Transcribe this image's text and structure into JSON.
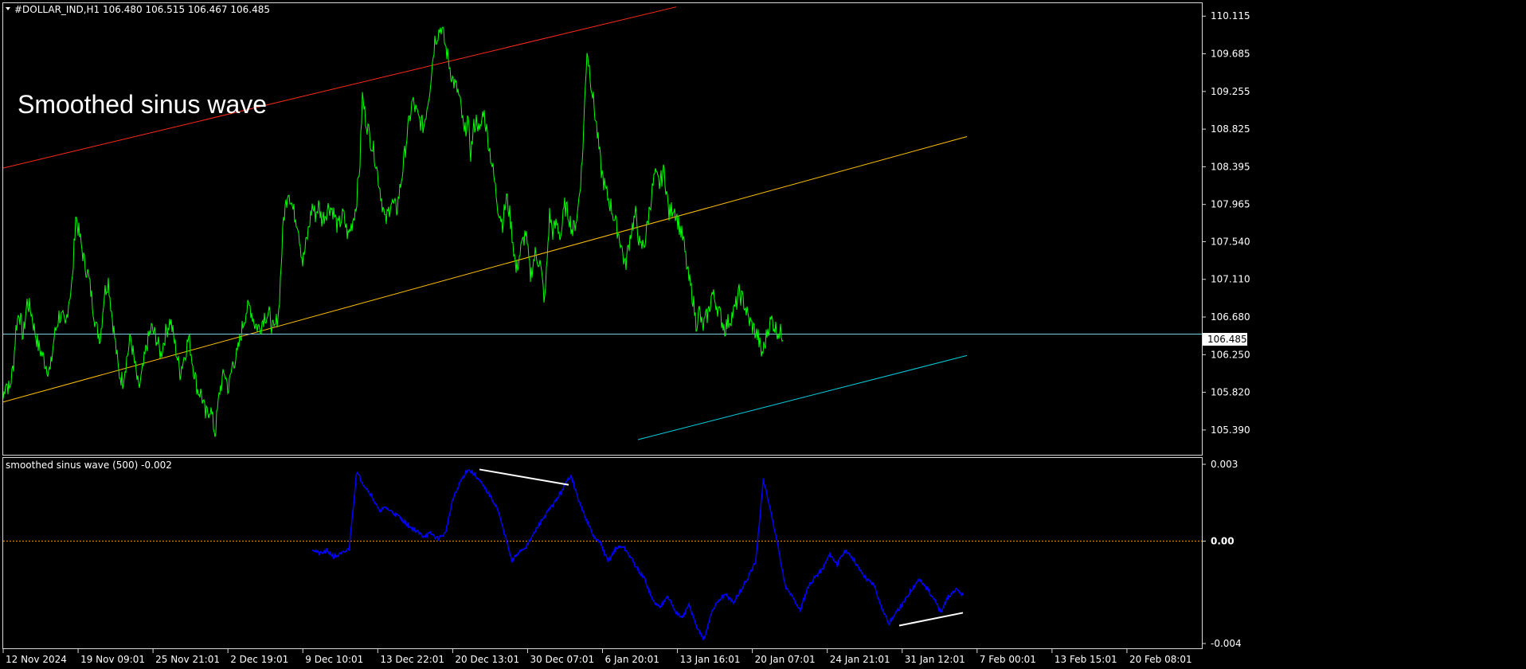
{
  "symbol_header": "#DOLLAR_IND,H1",
  "ohlc": {
    "open": "106.480",
    "high": "106.515",
    "low": "106.467",
    "close": "106.485"
  },
  "overlay_label": "Smoothed sinus wave",
  "indicator_header": "smoothed sinus wave  (500) -0.002",
  "current_price": "106.485",
  "colors": {
    "price_line": "#00ff00",
    "indicator_line": "#0000ff",
    "red_channel": "#ff2a1a",
    "yellow_channel": "#ffc000",
    "cyan_channel": "#00d0e0",
    "price_hline": "#7fcfe0",
    "zero_line": "#ff9900",
    "divergence": "#ffffff",
    "background": "#000000",
    "frame": "#d8d8d8"
  },
  "chart_data": [
    {
      "type": "line",
      "series_name": "#DOLLAR_IND,H1",
      "y_ticks": [
        "110.115",
        "109.685",
        "109.255",
        "108.825",
        "108.395",
        "107.965",
        "107.540",
        "107.110",
        "106.680",
        "106.250",
        "105.820",
        "105.390"
      ],
      "ylim": [
        105.28,
        110.19
      ],
      "x_ticks": [
        "12 Nov 2024",
        "19 Nov 09:01",
        "25 Nov 21:01",
        "2 Dec 19:01",
        "9 Dec 10:01",
        "13 Dec 22:01",
        "20 Dec 13:01",
        "30 Dec 07:01",
        "6 Jan 20:01",
        "13 Jan 16:01",
        "20 Jan 07:01",
        "24 Jan 21:01",
        "31 Jan 12:01",
        "7 Feb 00:01",
        "13 Feb 15:01",
        "20 Feb 08:01"
      ],
      "x_index": [
        0,
        3,
        8,
        13,
        16,
        20,
        25,
        30,
        35,
        39,
        44,
        49,
        53,
        59,
        64,
        70,
        75,
        78,
        82,
        87,
        91,
        97,
        102,
        107,
        112,
        117,
        122,
        127,
        132,
        136,
        140,
        145,
        150,
        155,
        160,
        165,
        170,
        175,
        180,
        186,
        192,
        198,
        204,
        210,
        216,
        222,
        228,
        233,
        238,
        244,
        249,
        254,
        260,
        266,
        272,
        278,
        283,
        288,
        294,
        300,
        305,
        310,
        316,
        322,
        328,
        334,
        340,
        346,
        352,
        358,
        364,
        370,
        376,
        382,
        388,
        392,
        396,
        400,
        404,
        409,
        414,
        420,
        427,
        433,
        438,
        443,
        448,
        451,
        455,
        460,
        466,
        473,
        480,
        487,
        494,
        500,
        507,
        514,
        521,
        528,
        535,
        542,
        550,
        557,
        564,
        571,
        575,
        579,
        583,
        587,
        591,
        595,
        598,
        603,
        609,
        615,
        621,
        627,
        632,
        636,
        640,
        644,
        650,
        656,
        662,
        668,
        674,
        680,
        686,
        690,
        695,
        700,
        705,
        710,
        715,
        721,
        727,
        733,
        739,
        745,
        751,
        757,
        763,
        769,
        775,
        781,
        788,
        794,
        800,
        806,
        812,
        818,
        824,
        830,
        836,
        842,
        848,
        854,
        860,
        866,
        870,
        874,
        878,
        882,
        886,
        890,
        895,
        900,
        906,
        912,
        918,
        924,
        930,
        936,
        942,
        948,
        952,
        956,
        960,
        965,
        970,
        975,
        980,
        985,
        990,
        995,
        1000,
        1005,
        1010,
        1016,
        1022,
        1028,
        1034,
        1040,
        1046,
        1052,
        1058,
        1064,
        1070,
        1076,
        1082,
        1086,
        1090,
        1095,
        1100,
        1105,
        1110,
        1115,
        1120,
        1125,
        1130,
        1135,
        1140,
        1145,
        1150,
        1155,
        1160,
        1166,
        1172,
        1178,
        1184,
        1188,
        1192,
        1196,
        1200,
        1205
      ],
      "price": [
        105.75,
        105.95,
        105.85,
        106.15,
        106.55,
        106.75,
        106.45,
        106.85,
        106.75,
        106.55,
        106.35,
        106.25,
        106.15,
        106.05,
        106.45,
        106.7,
        106.65,
        106.55,
        106.85,
        107.1,
        107.85,
        107.55,
        107.3,
        107.15,
        106.85,
        106.55,
        106.45,
        106.95,
        107.1,
        106.75,
        106.45,
        106.05,
        105.95,
        106.2,
        106.45,
        106.15,
        105.85,
        106.05,
        106.35,
        106.55,
        106.45,
        106.25,
        106.5,
        106.65,
        106.35,
        106.05,
        106.25,
        106.45,
        106.15,
        105.85,
        105.8,
        105.55,
        105.65,
        105.35,
        105.85,
        106.05,
        105.85,
        106.15,
        106.25,
        106.55,
        106.75,
        106.8,
        106.6,
        106.55,
        106.7,
        106.7,
        106.5,
        106.75,
        107.8,
        108.15,
        107.9,
        107.75,
        107.3,
        107.6,
        107.95,
        107.85,
        107.95,
        107.8,
        107.85,
        107.95,
        107.9,
        107.7,
        107.85,
        107.6,
        107.75,
        107.95,
        108.45,
        109.2,
        108.95,
        108.75,
        108.55,
        108.15,
        107.75,
        108.0,
        107.9,
        108.25,
        108.75,
        109.15,
        108.95,
        108.85,
        109.25,
        109.85,
        110.0,
        109.7,
        109.4,
        109.25,
        109.05,
        108.75,
        108.95,
        108.55,
        108.85,
        108.95,
        108.75,
        109.05,
        108.7,
        108.35,
        107.95,
        107.75,
        108.05,
        107.85,
        107.55,
        107.2,
        107.45,
        107.65,
        107.15,
        107.4,
        107.3,
        106.85,
        107.85,
        107.65,
        107.75,
        107.6,
        107.95,
        107.85,
        107.65,
        107.85,
        108.45,
        109.75,
        109.3,
        108.85,
        108.35,
        108.1,
        107.95,
        107.75,
        107.55,
        107.25,
        107.65,
        107.85,
        107.45,
        107.55,
        107.95,
        108.3,
        108.2,
        108.35,
        107.85,
        107.95,
        107.75,
        107.55,
        107.15,
        106.9,
        106.6,
        106.75,
        106.55,
        106.65,
        106.75,
        106.95,
        106.85,
        106.7,
        106.55,
        106.65,
        106.75,
        106.95,
        106.85,
        106.65,
        106.55,
        106.45,
        106.25,
        106.35,
        106.55,
        106.65,
        106.55,
        106.5,
        106.485
      ],
      "indicator_ylim": [
        -0.004,
        0.003
      ],
      "indicator_ticks": [
        "0.003",
        "0.00",
        "-0.004"
      ],
      "indicator_start_index": 388,
      "indicator": [
        -0.0003,
        -0.0005,
        -0.0004,
        -0.0006,
        -0.0005,
        -0.0003,
        0.0027,
        0.0022,
        0.0018,
        0.0012,
        0.0013,
        0.0011,
        0.0009,
        0.0006,
        0.0004,
        0.0002,
        0.0003,
        0.0001,
        0.0003,
        0.0016,
        0.0023,
        0.0028,
        0.0026,
        0.0022,
        0.0018,
        0.0013,
        0.0003,
        -0.0008,
        -0.0004,
        -0.0002,
        0.0003,
        0.0008,
        0.0012,
        0.0016,
        0.0021,
        0.0026,
        0.0016,
        0.0009,
        0.0002,
        -0.0001,
        -0.0008,
        -0.0003,
        -0.0002,
        -0.0006,
        -0.0011,
        -0.0015,
        -0.0023,
        -0.0026,
        -0.0021,
        -0.0027,
        -0.003,
        -0.0025,
        -0.0034,
        -0.0038,
        -0.0028,
        -0.0023,
        -0.0021,
        -0.0024,
        -0.0019,
        -0.0014,
        -0.0008,
        0.0024,
        0.0012,
        -0.0002,
        -0.0018,
        -0.0022,
        -0.0027,
        -0.0018,
        -0.0014,
        -0.0011,
        -0.0005,
        -0.0009,
        -0.0004,
        -0.0006,
        -0.0011,
        -0.0015,
        -0.0017,
        -0.0026,
        -0.0032,
        -0.0028,
        -0.0024,
        -0.0019,
        -0.0015,
        -0.0018,
        -0.0022,
        -0.0028,
        -0.0022,
        -0.0019,
        -0.0021
      ],
      "divergence_lines": [
        {
          "x1": 598,
          "y1": 0.0028,
          "x2": 710,
          "y2": 0.0022
        },
        {
          "x1": 1125,
          "y1": -0.0033,
          "x2": 1205,
          "y2": -0.0028
        }
      ],
      "channel_lines": [
        {
          "name": "red",
          "x1": 0,
          "y1": 108.38,
          "x2": 845,
          "y2": 110.22
        },
        {
          "name": "yellow",
          "x1": 0,
          "y1": 105.71,
          "x2": 1210,
          "y2": 108.74
        },
        {
          "name": "cyan",
          "x1": 797,
          "y1": 105.28,
          "x2": 1210,
          "y2": 106.24
        }
      ],
      "grid": false
    }
  ]
}
